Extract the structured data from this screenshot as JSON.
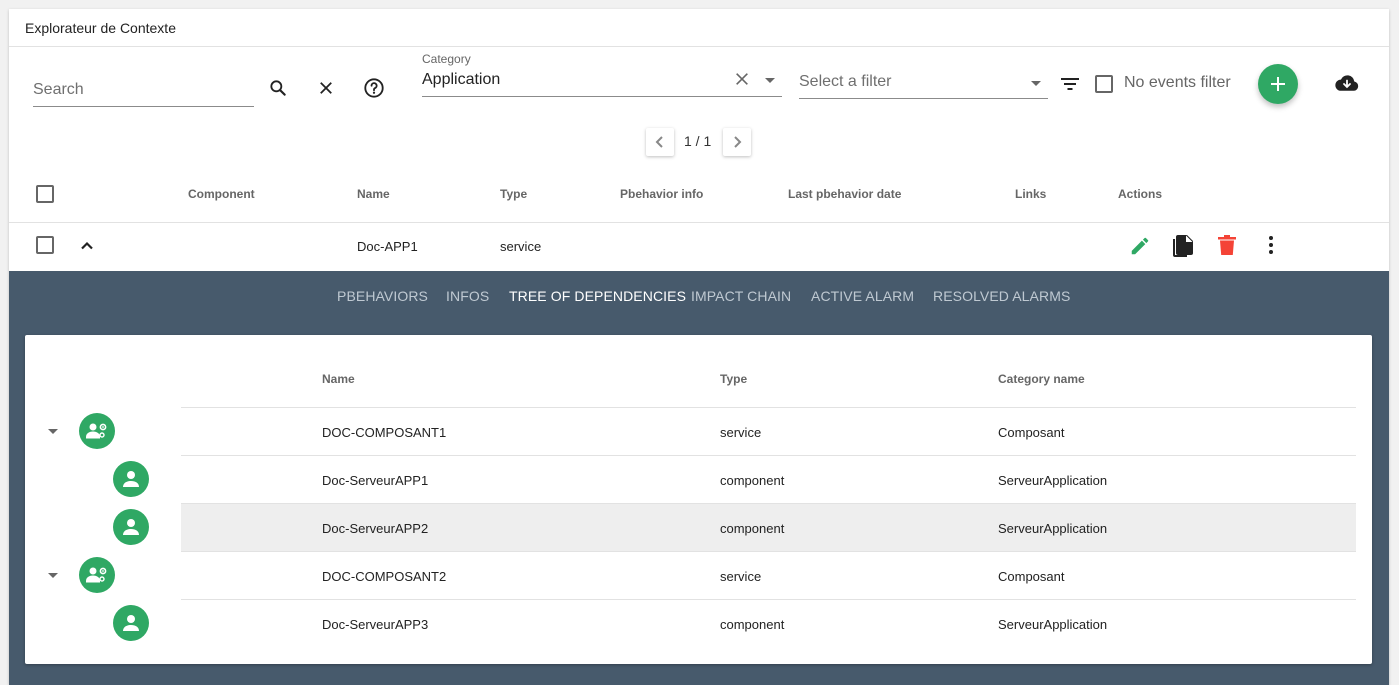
{
  "window": {
    "title": "Explorateur de Contexte"
  },
  "toolbar": {
    "search_placeholder": "Search",
    "category": {
      "label": "Category",
      "value": "Application"
    },
    "filter": {
      "placeholder": "Select a filter"
    },
    "no_events_label": "No events filter"
  },
  "pagination": {
    "text": "1 / 1"
  },
  "table": {
    "headers": {
      "component": "Component",
      "name": "Name",
      "type": "Type",
      "pbehavior_info": "Pbehavior info",
      "last_pbehavior_date": "Last pbehavior date",
      "links": "Links",
      "actions": "Actions"
    },
    "rows": [
      {
        "component": "",
        "name": "Doc-APP1",
        "type": "service"
      }
    ]
  },
  "tabs": [
    {
      "label": "Pbehaviors",
      "active": false
    },
    {
      "label": "Infos",
      "active": false
    },
    {
      "label": "Tree of dependencies",
      "active": true
    },
    {
      "label": "Impact chain",
      "active": false
    },
    {
      "label": "Active alarm",
      "active": false
    },
    {
      "label": "Resolved alarms",
      "active": false
    }
  ],
  "dependencies": {
    "headers": {
      "name": "Name",
      "type": "Type",
      "category": "Category name"
    },
    "rows": [
      {
        "name": "DOC-COMPOSANT1",
        "type": "service",
        "category": "Composant",
        "icon": "service-icon",
        "level": 0,
        "expandable": true
      },
      {
        "name": "Doc-ServeurAPP1",
        "type": "component",
        "category": "ServeurApplication",
        "icon": "component-icon",
        "level": 1,
        "expandable": false
      },
      {
        "name": "Doc-ServeurAPP2",
        "type": "component",
        "category": "ServeurApplication",
        "icon": "component-icon",
        "level": 1,
        "expandable": false,
        "highlighted": true
      },
      {
        "name": "DOC-COMPOSANT2",
        "type": "service",
        "category": "Composant",
        "icon": "service-icon",
        "level": 0,
        "expandable": true
      },
      {
        "name": "Doc-ServeurAPP3",
        "type": "component",
        "category": "ServeurApplication",
        "icon": "component-icon",
        "level": 1,
        "expandable": false
      }
    ]
  },
  "colors": {
    "accent_green": "#2fa864",
    "delete_red": "#f44336",
    "panel_bg": "#475a6c"
  }
}
